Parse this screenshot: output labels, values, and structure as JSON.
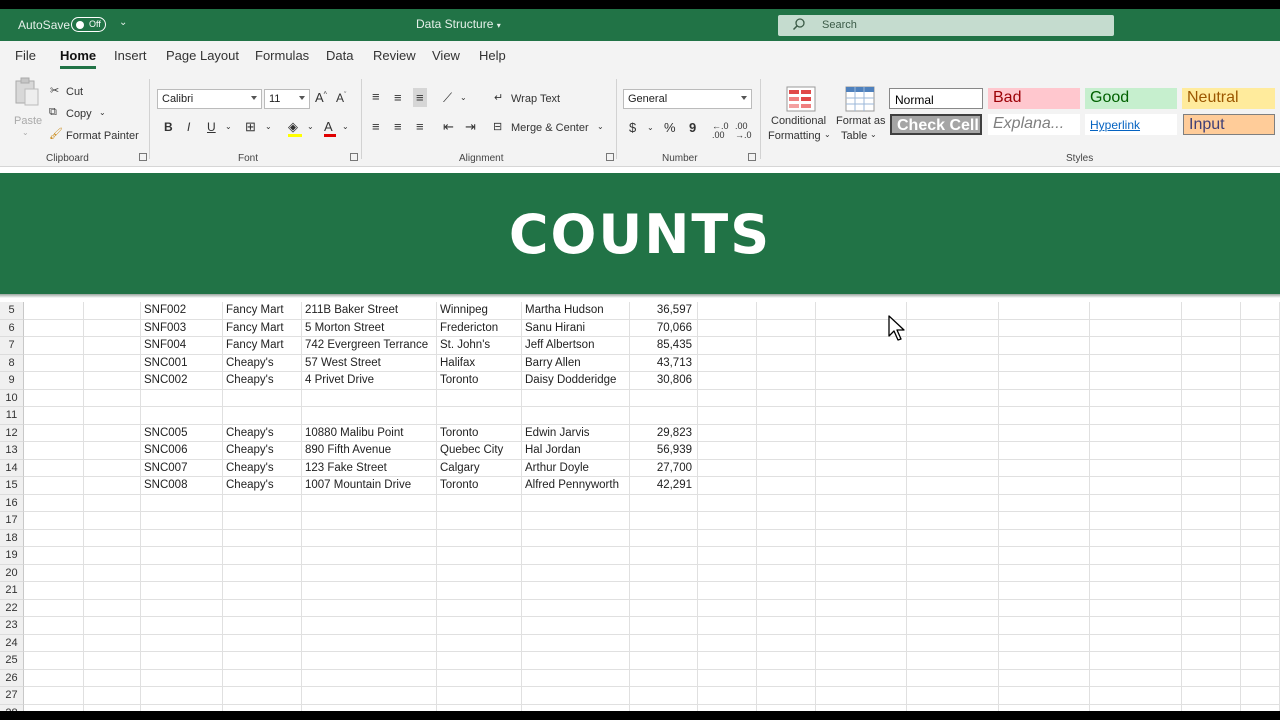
{
  "titlebar": {
    "autosave_label": "AutoSave",
    "autosave_state": "Off",
    "qat_glyph": "⌄",
    "doc_title": "Data Structure",
    "search_placeholder": "Search"
  },
  "tabs": [
    "File",
    "Home",
    "Insert",
    "Page Layout",
    "Formulas",
    "Data",
    "Review",
    "View",
    "Help"
  ],
  "active_tab": "Home",
  "clipboard": {
    "paste": "Paste",
    "cut": "Cut",
    "copy": "Copy",
    "format_painter": "Format Painter",
    "group": "Clipboard"
  },
  "font": {
    "name": "Calibri",
    "size": "11",
    "group": "Font",
    "bold": "B",
    "italic": "I",
    "underline": "U"
  },
  "alignment": {
    "wrap_text": "Wrap Text",
    "merge_center": "Merge & Center",
    "group": "Alignment"
  },
  "number": {
    "format": "General",
    "currency": "$",
    "percent": "%",
    "comma": "9",
    "group": "Number"
  },
  "styles": {
    "conditional_formatting_1": "Conditional",
    "conditional_formatting_2": "Formatting",
    "format_as_table_1": "Format as",
    "format_as_table_2": "Table",
    "group": "Styles",
    "cells": [
      {
        "label": "Normal",
        "bg": "#ffffff",
        "fg": "#000000"
      },
      {
        "label": "Bad",
        "bg": "#ffc7ce",
        "fg": "#9c0006"
      },
      {
        "label": "Good",
        "bg": "#c6efce",
        "fg": "#006100"
      },
      {
        "label": "Neutral",
        "bg": "#ffeb9c",
        "fg": "#9c5700"
      },
      {
        "label": "Check Cell",
        "bg": "#a5a5a5",
        "fg": "#ffffff"
      },
      {
        "label": "Explana...",
        "bg": "#ffffff",
        "fg": "#7f7f7f"
      },
      {
        "label": "Hyperlink",
        "bg": "#ffffff",
        "fg": "#0563c1"
      },
      {
        "label": "Input",
        "bg": "#ffcc99",
        "fg": "#3f3f76"
      }
    ]
  },
  "banner": {
    "title": "COUNTS",
    "color": "#217346"
  },
  "sheet": {
    "rows": [
      {
        "n": "5",
        "cells": [
          "",
          "",
          "SNF002",
          "Fancy Mart",
          "211B Baker Street",
          "Winnipeg",
          "Martha Hudson",
          "36,597"
        ]
      },
      {
        "n": "6",
        "cells": [
          "",
          "",
          "SNF003",
          "Fancy Mart",
          "5 Morton Street",
          "Fredericton",
          "Sanu Hirani",
          "70,066"
        ]
      },
      {
        "n": "7",
        "cells": [
          "",
          "",
          "SNF004",
          "Fancy Mart",
          "742 Evergreen Terrance",
          "St. John's",
          "Jeff Albertson",
          "85,435"
        ]
      },
      {
        "n": "8",
        "cells": [
          "",
          "",
          "SNC001",
          "Cheapy's",
          "57 West Street",
          "Halifax",
          "Barry Allen",
          "43,713"
        ]
      },
      {
        "n": "9",
        "cells": [
          "",
          "",
          "SNC002",
          "Cheapy's",
          "4 Privet Drive",
          "Toronto",
          "Daisy Dodderidge",
          "30,806"
        ]
      },
      {
        "n": "10",
        "cells": [
          "",
          "",
          "",
          "",
          "",
          "",
          "",
          ""
        ]
      },
      {
        "n": "11",
        "cells": [
          "",
          "",
          "",
          "",
          "",
          "",
          "",
          ""
        ]
      },
      {
        "n": "12",
        "cells": [
          "",
          "",
          "SNC005",
          "Cheapy's",
          "10880 Malibu Point",
          "Toronto",
          "Edwin Jarvis",
          "29,823"
        ]
      },
      {
        "n": "13",
        "cells": [
          "",
          "",
          "SNC006",
          "Cheapy's",
          "890 Fifth Avenue",
          "Quebec City",
          "Hal Jordan",
          "56,939"
        ]
      },
      {
        "n": "14",
        "cells": [
          "",
          "",
          "SNC007",
          "Cheapy's",
          "123 Fake Street",
          "Calgary",
          "Arthur Doyle",
          "27,700"
        ]
      },
      {
        "n": "15",
        "cells": [
          "",
          "",
          "SNC008",
          "Cheapy's",
          "1007 Mountain Drive",
          "Toronto",
          "Alfred Pennyworth",
          "42,291"
        ]
      },
      {
        "n": "16",
        "cells": [
          "",
          "",
          "",
          "",
          "",
          "",
          "",
          ""
        ]
      },
      {
        "n": "17",
        "cells": [
          "",
          "",
          "",
          "",
          "",
          "",
          "",
          ""
        ]
      },
      {
        "n": "18",
        "cells": [
          "",
          "",
          "",
          "",
          "",
          "",
          "",
          ""
        ]
      },
      {
        "n": "19",
        "cells": [
          "",
          "",
          "",
          "",
          "",
          "",
          "",
          ""
        ]
      },
      {
        "n": "20",
        "cells": [
          "",
          "",
          "",
          "",
          "",
          "",
          "",
          ""
        ]
      },
      {
        "n": "21",
        "cells": [
          "",
          "",
          "",
          "",
          "",
          "",
          "",
          ""
        ]
      },
      {
        "n": "22",
        "cells": [
          "",
          "",
          "",
          "",
          "",
          "",
          "",
          ""
        ]
      },
      {
        "n": "23",
        "cells": [
          "",
          "",
          "",
          "",
          "",
          "",
          "",
          ""
        ]
      },
      {
        "n": "24",
        "cells": [
          "",
          "",
          "",
          "",
          "",
          "",
          "",
          ""
        ]
      },
      {
        "n": "25",
        "cells": [
          "",
          "",
          "",
          "",
          "",
          "",
          "",
          ""
        ]
      },
      {
        "n": "26",
        "cells": [
          "",
          "",
          "",
          "",
          "",
          "",
          "",
          ""
        ]
      },
      {
        "n": "27",
        "cells": [
          "",
          "",
          "",
          "",
          "",
          "",
          "",
          ""
        ]
      },
      {
        "n": "28",
        "cells": [
          "",
          "",
          "",
          "",
          "",
          "",
          "",
          ""
        ]
      }
    ]
  }
}
